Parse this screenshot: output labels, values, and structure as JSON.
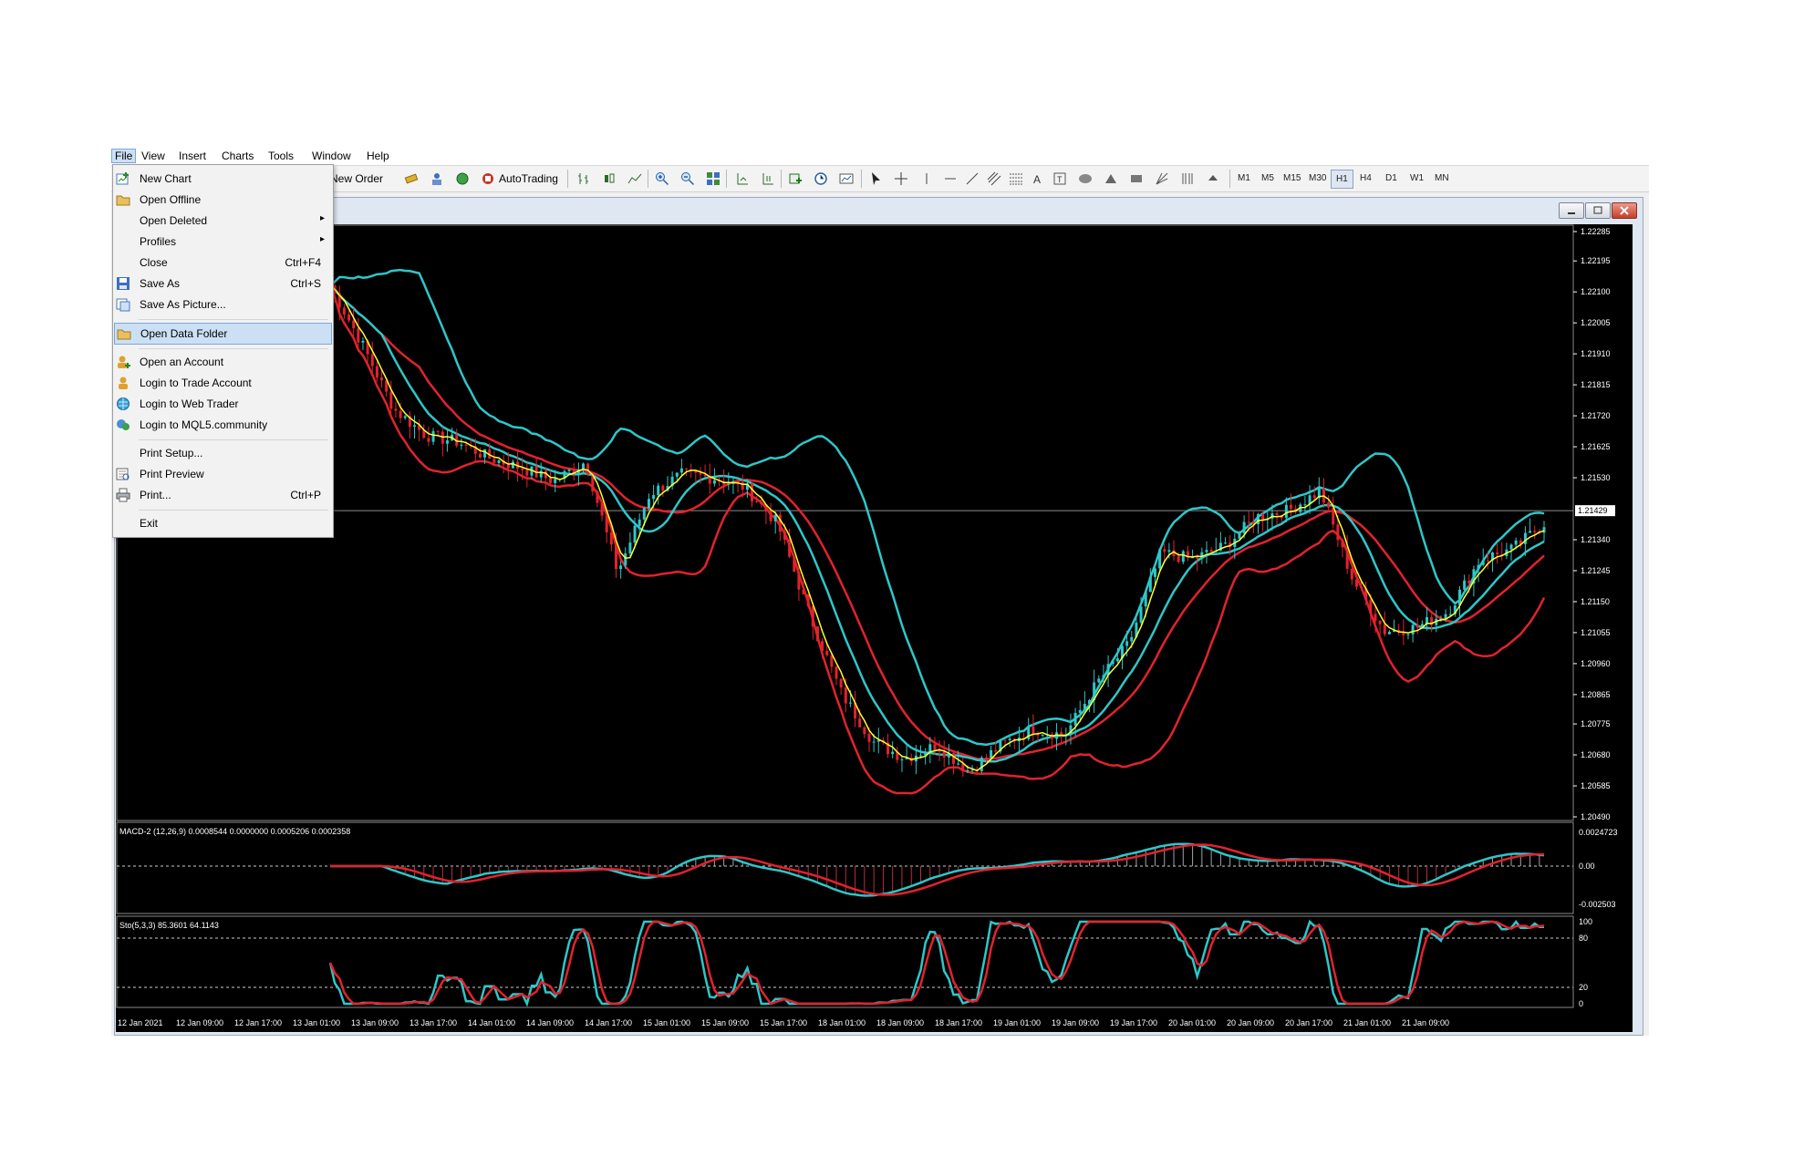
{
  "menubar": [
    "File",
    "View",
    "Insert",
    "Charts",
    "Tools",
    "Window",
    "Help"
  ],
  "toolbar": {
    "new_order": "New Order",
    "autotrading": "AutoTrading",
    "timeframes": [
      "M1",
      "M5",
      "M15",
      "M30",
      "H1",
      "H4",
      "D1",
      "W1",
      "MN"
    ],
    "active_timeframe": "H1"
  },
  "file_menu": [
    {
      "label": "New Chart",
      "icon": "new-chart-icon"
    },
    {
      "label": "Open Offline",
      "icon": "folder-icon"
    },
    {
      "label": "Open Deleted",
      "submenu": true
    },
    {
      "label": "Profiles",
      "submenu": true
    },
    {
      "label": "Close",
      "shortcut": "Ctrl+F4"
    },
    {
      "label": "Save As",
      "shortcut": "Ctrl+S",
      "icon": "save-icon"
    },
    {
      "label": "Save As Picture...",
      "icon": "picture-icon"
    },
    {
      "separator": true
    },
    {
      "label": "Open Data Folder",
      "icon": "folder-icon",
      "highlighted": true
    },
    {
      "separator": true
    },
    {
      "label": "Open an Account",
      "icon": "add-user-icon"
    },
    {
      "label": "Login to Trade Account",
      "icon": "user-icon"
    },
    {
      "label": "Login to Web Trader",
      "icon": "globe-icon"
    },
    {
      "label": "Login to MQL5.community",
      "icon": "community-icon"
    },
    {
      "separator": true
    },
    {
      "label": "Print Setup..."
    },
    {
      "label": "Print Preview",
      "icon": "print-preview-icon"
    },
    {
      "label": "Print...",
      "shortcut": "Ctrl+P",
      "icon": "printer-icon"
    },
    {
      "separator": true
    },
    {
      "label": "Exit"
    }
  ],
  "chart_data": {
    "type": "candlestick",
    "price_axis": [
      "1.22285",
      "1.22195",
      "1.22100",
      "1.22005",
      "1.21910",
      "1.21815",
      "1.21720",
      "1.21625",
      "1.21530",
      "1.21429",
      "1.21340",
      "1.21245",
      "1.21150",
      "1.21055",
      "1.20960",
      "1.20865",
      "1.20775",
      "1.20680",
      "1.20585",
      "1.20490"
    ],
    "current_price": "1.21429",
    "ylim": [
      1.2049,
      1.22285
    ],
    "time_axis": [
      "12 Jan 2021",
      "12 Jan 09:00",
      "12 Jan 17:00",
      "13 Jan 01:00",
      "13 Jan 09:00",
      "13 Jan 17:00",
      "14 Jan 01:00",
      "14 Jan 09:00",
      "14 Jan 17:00",
      "15 Jan 01:00",
      "15 Jan 09:00",
      "15 Jan 17:00",
      "18 Jan 01:00",
      "18 Jan 09:00",
      "18 Jan 17:00",
      "19 Jan 01:00",
      "19 Jan 09:00",
      "19 Jan 17:00",
      "20 Jan 01:00",
      "20 Jan 09:00",
      "20 Jan 17:00",
      "21 Jan 01:00",
      "21 Jan 09:00"
    ],
    "close_path": [
      1.2212,
      1.2194,
      1.2174,
      1.2166,
      1.2164,
      1.2159,
      1.2156,
      1.2152,
      1.2158,
      1.2124,
      1.2148,
      1.2154,
      1.2153,
      1.215,
      1.2139,
      1.2111,
      1.2087,
      1.2072,
      1.2067,
      1.2071,
      1.2063,
      1.2071,
      1.2076,
      1.2074,
      1.209,
      1.2102,
      1.213,
      1.2128,
      1.2132,
      1.2141,
      1.2143,
      1.2149,
      1.2122,
      1.2106,
      1.2107,
      1.2112,
      1.2128,
      1.2131,
      1.2139
    ],
    "indicators": {
      "macd_label": "MACD-2 (12,26,9) 0.0008544 0.0000000 0.0005206 0.0002358",
      "macd_axis": [
        "0.0024723",
        "0.00",
        "-0.002503"
      ],
      "stoch_label": "Sto(5,3,3) 85.3601 64.1143",
      "stoch_axis": [
        "100",
        "80",
        "20",
        "0"
      ]
    }
  },
  "colors": {
    "bollinger": "#2ec7c9",
    "ma": "#e3222e",
    "price_line": "#ffff30",
    "bull": "#2ec7c9",
    "bear": "#e3222e"
  }
}
